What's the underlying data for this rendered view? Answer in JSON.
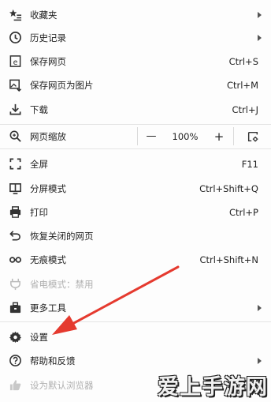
{
  "menu": {
    "favorites": {
      "label": "收藏夹"
    },
    "history": {
      "label": "历史记录"
    },
    "save_page": {
      "label": "保存网页",
      "shortcut": "Ctrl+S"
    },
    "save_as_image": {
      "label": "保存网页为图片",
      "shortcut": "Ctrl+M"
    },
    "downloads": {
      "label": "下载",
      "shortcut": "Ctrl+J"
    },
    "zoom": {
      "label": "网页缩放",
      "minus": "—",
      "value": "100%",
      "plus": "+"
    },
    "fullscreen": {
      "label": "全屏",
      "shortcut": "F11"
    },
    "split_mode": {
      "label": "分屏模式",
      "shortcut": "Ctrl+Shift+Q"
    },
    "print": {
      "label": "打印",
      "shortcut": "Ctrl+P"
    },
    "restore_closed": {
      "label": "恢复关闭的网页"
    },
    "incognito": {
      "label": "无痕模式",
      "shortcut": "Ctrl+Shift+N"
    },
    "power_save": {
      "label": "省电模式：禁用"
    },
    "more_tools": {
      "label": "更多工具"
    },
    "settings": {
      "label": "设置"
    },
    "help": {
      "label": "帮助和反馈"
    },
    "set_default": {
      "label": "设为默认浏览器"
    }
  },
  "watermark": {
    "text": "爱上手游网"
  },
  "colors": {
    "arrow": "#e53a2f",
    "disabled": "#b0b0b0"
  }
}
